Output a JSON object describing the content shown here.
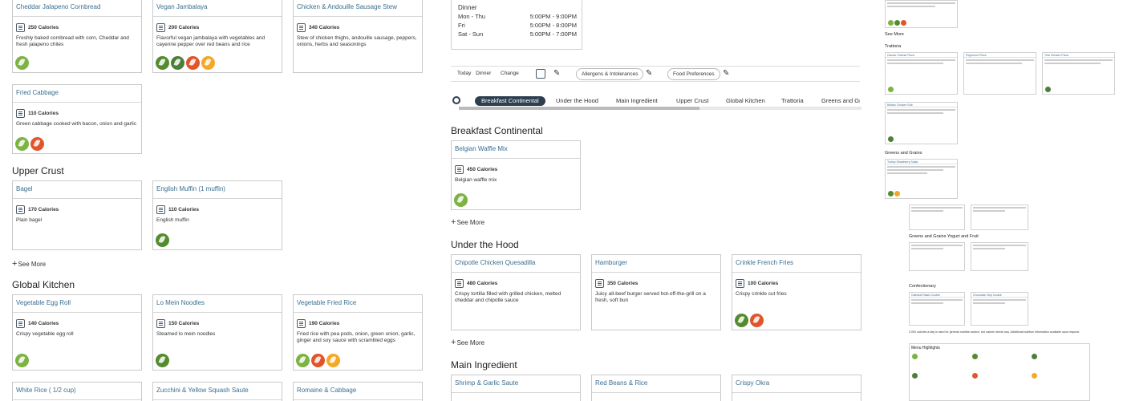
{
  "left_column": {
    "top_cards": [
      {
        "title": "Cheddar Jalapeno Cornbread",
        "calories": "250 Calories",
        "desc": "Freshly baked cornbread with corn, Cheddar and fresh jalapeno chiles",
        "icons": [
          "vegetarian-icon"
        ]
      },
      {
        "title": "Vegan Jambalaya",
        "calories": "200 Calories",
        "desc": "Flavorful vegan jambalaya with vegetables and cayenne pepper over red beans and rice",
        "icons": [
          "vegan-icon",
          "local-icon",
          "gluten-free-icon",
          "spicy-icon"
        ]
      },
      {
        "title": "Chicken & Andouille Sausage Stew",
        "calories": "340 Calories",
        "desc": "Stew of chicken thighs, andouille sausage, peppers, onions, herbs and seasonings",
        "icons": []
      }
    ],
    "fried_cabbage": {
      "title": "Fried Cabbage",
      "calories": "110 Calories",
      "desc": "Green cabbage cooked with bacon, onion and garlic",
      "icons": [
        "vegetarian-icon",
        "gluten-free-icon"
      ]
    },
    "upper_crust": {
      "heading": "Upper Crust",
      "cards": [
        {
          "title": "Bagel",
          "calories": "170 Calories",
          "desc": "Plain bagel",
          "icons": []
        },
        {
          "title": "English Muffin (1 muffin)",
          "calories": "110 Calories",
          "desc": "English muffin",
          "icons": [
            "vegan-icon"
          ]
        }
      ],
      "see_more": "See More"
    },
    "global_kitchen": {
      "heading": "Global Kitchen",
      "cards": [
        {
          "title": "Vegetable Egg Roll",
          "calories": "140 Calories",
          "desc": "Crispy vegetable egg roll",
          "icons": [
            "vegetarian-icon"
          ]
        },
        {
          "title": "Lo Mein Noodles",
          "calories": "150 Calories",
          "desc": "Steamed lo mein noodles",
          "icons": [
            "vegan-icon"
          ]
        },
        {
          "title": "Vegetable Fried Rice",
          "calories": "190 Calories",
          "desc": "Fried rice with pea pods, onion, green onion, garlic, ginger and soy sauce with scrambled eggs",
          "icons": [
            "vegetarian-icon",
            "gluten-free-icon",
            "spicy-icon"
          ]
        }
      ],
      "bottom_titles": [
        "White Rice ( 1/2 cup)",
        "Zucchini & Yellow Squash Saute",
        "Romaine & Cabbage"
      ]
    }
  },
  "hours": {
    "title": "Dinner",
    "rows": [
      {
        "days": "Mon - Thu",
        "time": "5:00PM - 9:00PM"
      },
      {
        "days": "Fri",
        "time": "5:00PM - 8:00PM"
      },
      {
        "days": "Sat - Sun",
        "time": "5:00PM - 7:00PM"
      }
    ]
  },
  "filter_bar": {
    "today_label": "Today",
    "today_value": "Dinner",
    "change": "Change",
    "allergens": "Allergens & Intolerances",
    "food_prefs": "Food Preferences"
  },
  "tabs": [
    "Breakfast Continental",
    "Under the Hood",
    "Main Ingredient",
    "Upper Crust",
    "Global Kitchen",
    "Trattoria",
    "Greens and Grains"
  ],
  "middle": {
    "breakfast": {
      "heading": "Breakfast Continental",
      "card": {
        "title": "Belgian Waffle Mix",
        "calories": "450 Calories",
        "desc": "Belgian waffle mix",
        "icons": [
          "vegetarian-icon"
        ]
      },
      "see_more": "See More"
    },
    "under_hood": {
      "heading": "Under the Hood",
      "cards": [
        {
          "title": "Chipotle Chicken Quesadilla",
          "calories": "480 Calories",
          "desc": "Crispy tortilla filled with grilled chicken, melted cheddar and chipotle sauce",
          "icons": []
        },
        {
          "title": "Hamburger",
          "calories": "350 Calories",
          "desc": "Juicy all-beef burger served hot-off-the-grill on a fresh, soft bun",
          "icons": []
        },
        {
          "title": "Crinkle French Fries",
          "calories": "100 Calories",
          "desc": "Crispy crinkle cut fries",
          "icons": [
            "vegan-icon",
            "gluten-free-icon"
          ]
        }
      ],
      "see_more": "See More"
    },
    "main_ingredient": {
      "heading": "Main Ingredient",
      "titles": [
        "Shrimp & Garlic Saute",
        "Red Beans & Rice",
        "Crispy Okra"
      ]
    }
  },
  "right_column": {
    "top_see_more": "See More",
    "trattoria": "Trattoria",
    "greens": "Greens and Grains",
    "greens_yogurt": "Greens and Grains Yogurt and Fruit",
    "confectionary": "Confectionary",
    "menu_highlights": "Menu Highlights",
    "footnote": "2,000 calories a day is used for general nutrition advice, but calorie needs vary. Additional nutrition information available upon request.",
    "trattoria_items": [
      "Classic Cheese Pizza",
      "Pepperoni Pizza",
      "Thai Chicken Pizza",
      "Buffalo Chicken Sub"
    ],
    "greens_items": [
      "Turkey Strawberry Salad"
    ],
    "confectionary_items": [
      "Oatmeal Raisin Cookie",
      "Chocolate Chip Cookie"
    ]
  },
  "colors": {
    "title_link": "#3b6e8f",
    "active_tab": "#2c3e50",
    "vegetarian": "#7cb342",
    "vegan": "#558b2f",
    "gluten_free": "#e0552b",
    "spicy": "#f4a825"
  }
}
